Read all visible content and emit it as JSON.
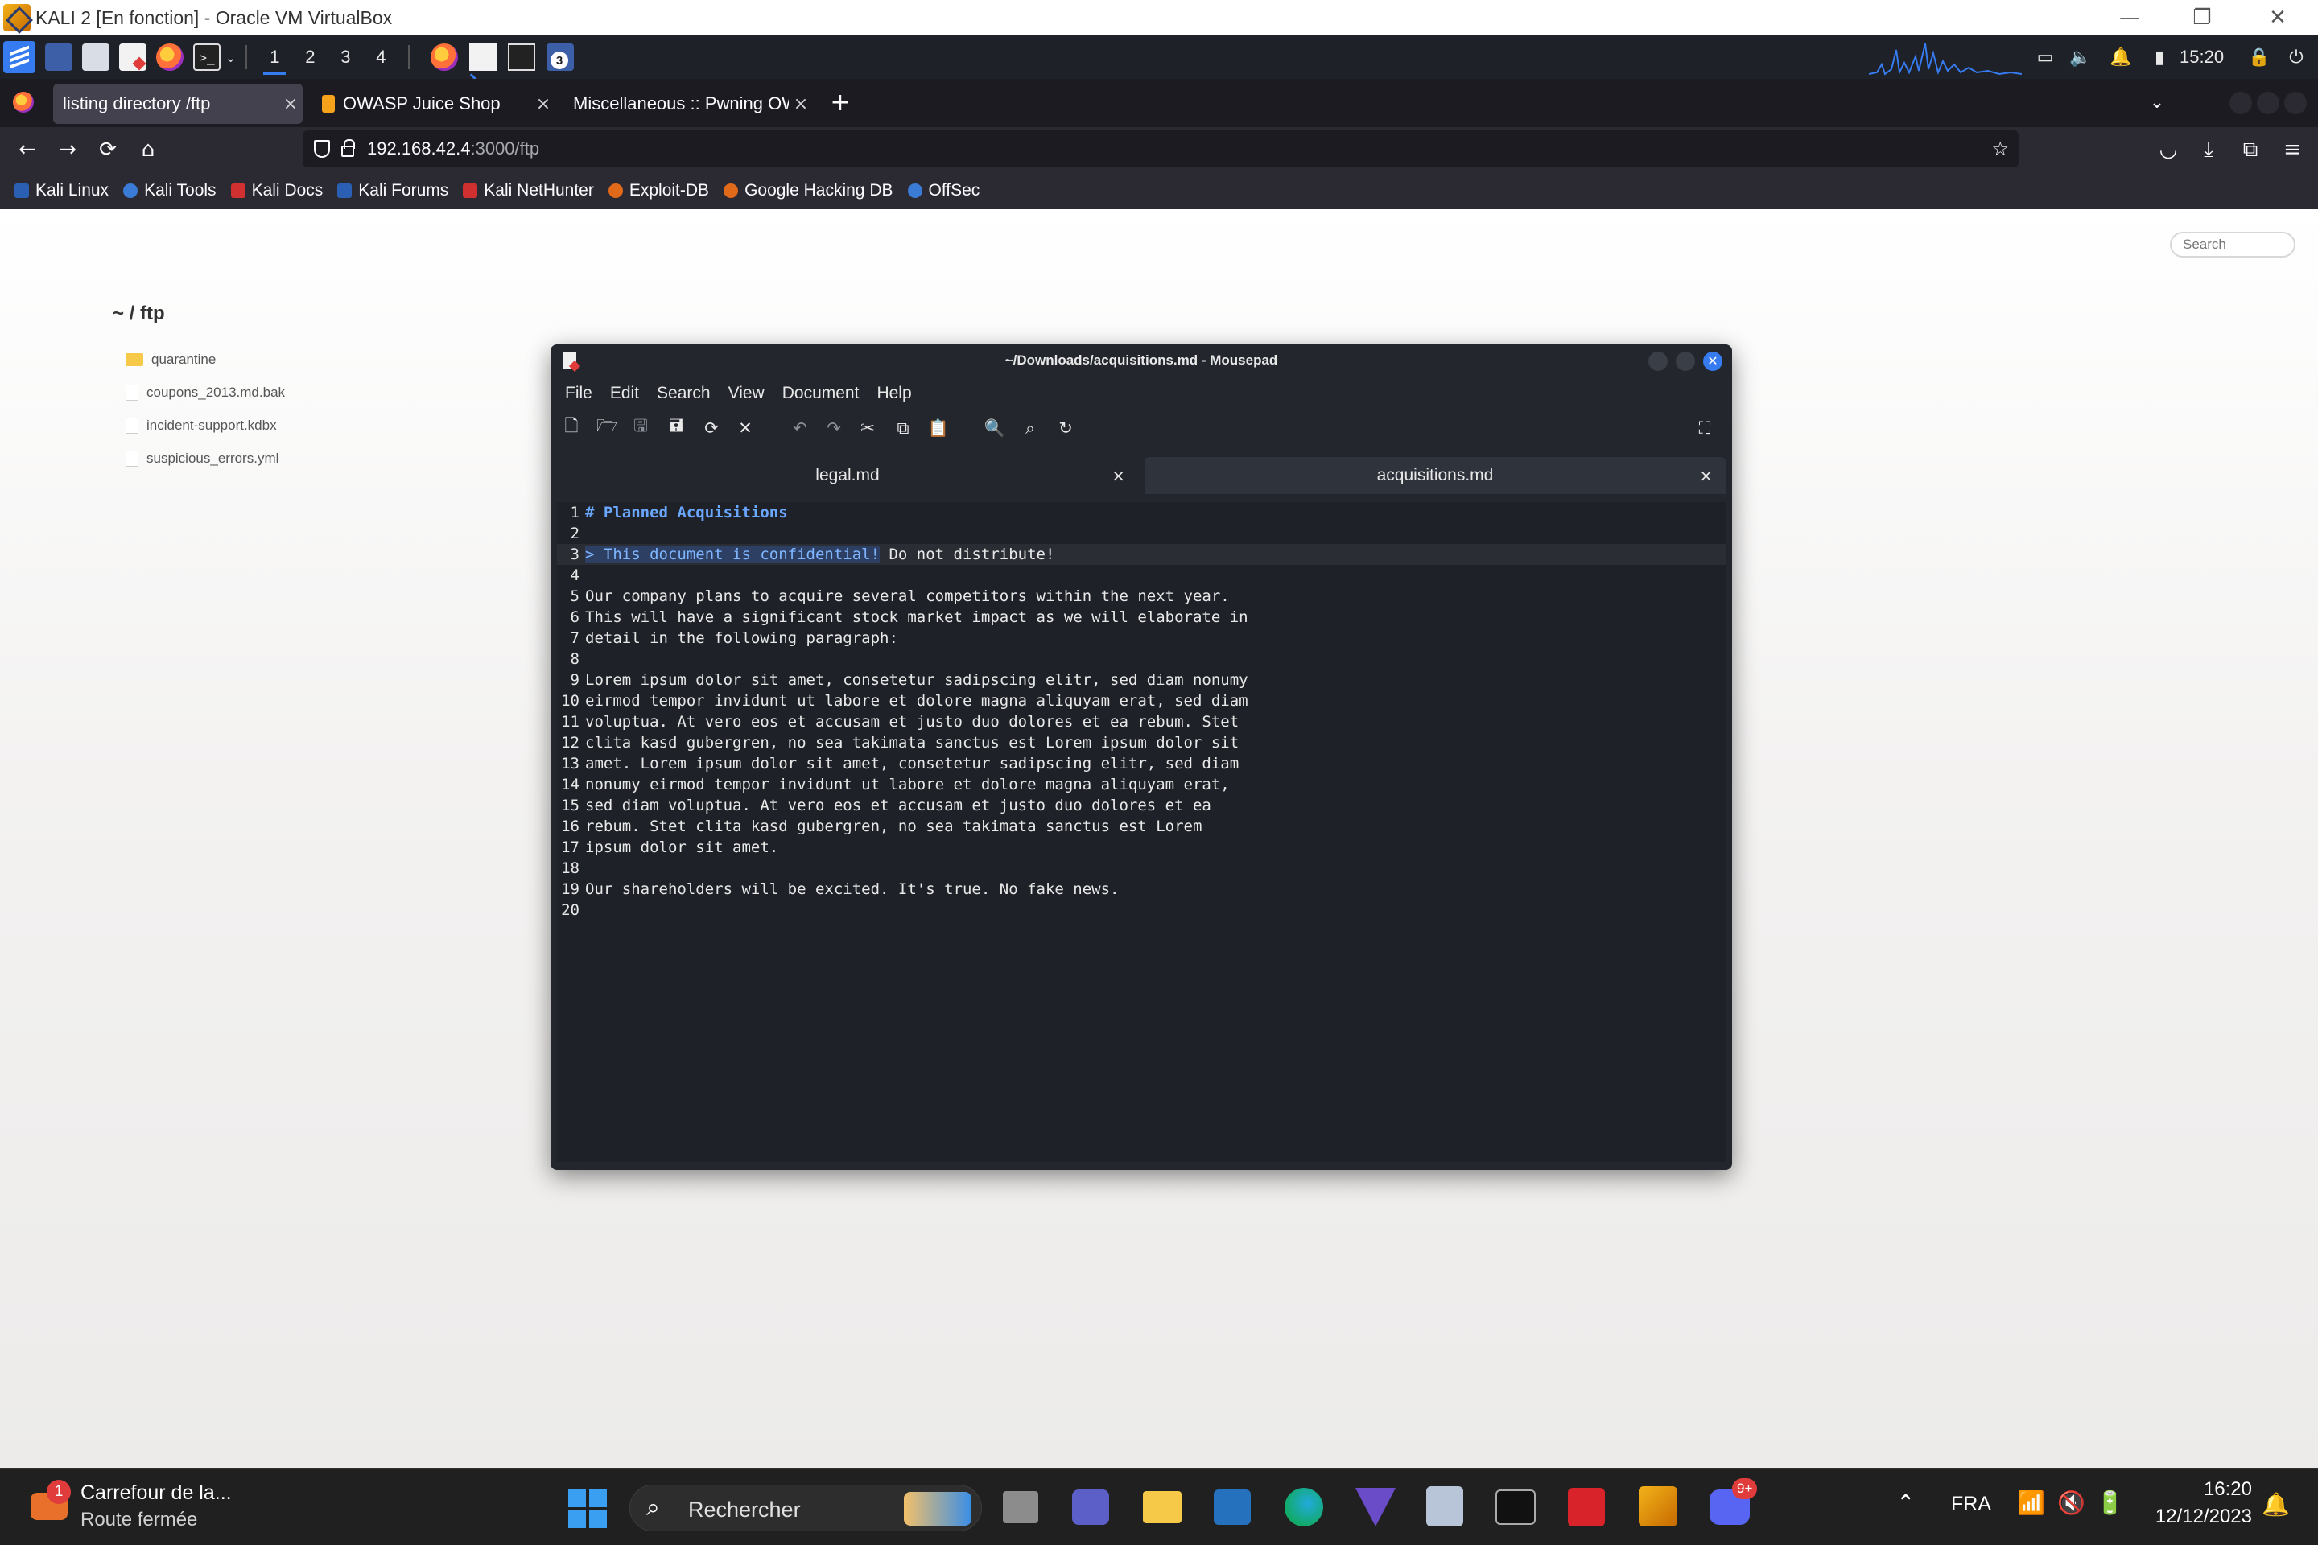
{
  "vbox": {
    "title": "KALI 2 [En fonction] - Oracle VM VirtualBox",
    "minimize": "—",
    "maximize": "❐",
    "close": "✕"
  },
  "kali_panel": {
    "workspaces": [
      "1",
      "2",
      "3",
      "4"
    ],
    "active_workspace": "1",
    "task_badge": "3",
    "terminal_glyph": ">_",
    "clock": "15:20",
    "icons": [
      "kali-menu-icon",
      "desktop-icon",
      "files-icon",
      "text-editor-icon",
      "firefox-icon",
      "terminal-icon",
      "network-graph-icon",
      "display-icon",
      "volume-icon",
      "notification-bell-icon",
      "battery-icon",
      "lock-icon",
      "power-icon"
    ]
  },
  "firefox": {
    "tabs": [
      {
        "label": "listing directory /ftp",
        "close": "×"
      },
      {
        "label": "OWASP Juice Shop",
        "close": "×"
      },
      {
        "label": "Miscellaneous :: Pwning OWASP Juice Shop",
        "close": "×"
      }
    ],
    "new_tab": "+",
    "tab_list": "⌄",
    "nav": {
      "back": "←",
      "forward": "→",
      "reload": "⟳",
      "home": "⌂"
    },
    "url_host": "192.168.42.4",
    "url_path": ":3000/ftp",
    "bookmark_star": "☆",
    "toolbar": {
      "pocket": "◡",
      "downloads": "⤓",
      "extensions": "⧉",
      "menu": "≡"
    },
    "bookmarks": [
      {
        "label": "Kali Linux",
        "color": "#2b5fb4"
      },
      {
        "label": "Kali Tools",
        "color": "#3a7bd5"
      },
      {
        "label": "Kali Docs",
        "color": "#d03030"
      },
      {
        "label": "Kali Forums",
        "color": "#2b5fb4"
      },
      {
        "label": "Kali NetHunter",
        "color": "#d03030"
      },
      {
        "label": "Exploit-DB",
        "color": "#e06a1a"
      },
      {
        "label": "Google Hacking DB",
        "color": "#e06a1a"
      },
      {
        "label": "OffSec",
        "color": "#3a7bd5"
      }
    ]
  },
  "page": {
    "search_placeholder": "Search",
    "title": "~ / ftp",
    "items": [
      {
        "name": "quarantine",
        "type": "folder"
      },
      {
        "name": "coupons_2013.md.bak",
        "type": "file"
      },
      {
        "name": "incident-support.kdbx",
        "type": "file"
      },
      {
        "name": "suspicious_errors.yml",
        "type": "file"
      }
    ]
  },
  "mousepad": {
    "title": "~/Downloads/acquisitions.md - Mousepad",
    "close_glyph": "✕",
    "menu": [
      "File",
      "Edit",
      "Search",
      "View",
      "Document",
      "Help"
    ],
    "toolbar": [
      "new",
      "open",
      "save",
      "save-as",
      "reload",
      "close",
      "undo",
      "redo",
      "cut",
      "copy",
      "paste",
      "find",
      "find-replace",
      "go-to-line",
      "fullscreen"
    ],
    "tabs": [
      {
        "label": "legal.md",
        "close": "×",
        "active": false
      },
      {
        "label": "acquisitions.md",
        "close": "×",
        "active": true
      }
    ],
    "lines": [
      {
        "n": "1",
        "text": "# Planned Acquisitions"
      },
      {
        "n": "2",
        "text": ""
      },
      {
        "n": "3",
        "text": "> This document is confidential! Do not distribute!"
      },
      {
        "n": "4",
        "text": ""
      },
      {
        "n": "5",
        "text": "Our company plans to acquire several competitors within the next year."
      },
      {
        "n": "6",
        "text": "This will have a significant stock market impact as we will elaborate in"
      },
      {
        "n": "7",
        "text": "detail in the following paragraph:"
      },
      {
        "n": "8",
        "text": ""
      },
      {
        "n": "9",
        "text": "Lorem ipsum dolor sit amet, consetetur sadipscing elitr, sed diam nonumy"
      },
      {
        "n": "10",
        "text": "eirmod tempor invidunt ut labore et dolore magna aliquyam erat, sed diam"
      },
      {
        "n": "11",
        "text": "voluptua. At vero eos et accusam et justo duo dolores et ea rebum. Stet"
      },
      {
        "n": "12",
        "text": "clita kasd gubergren, no sea takimata sanctus est Lorem ipsum dolor sit"
      },
      {
        "n": "13",
        "text": "amet. Lorem ipsum dolor sit amet, consetetur sadipscing elitr, sed diam"
      },
      {
        "n": "14",
        "text": "nonumy eirmod tempor invidunt ut labore et dolore magna aliquyam erat,"
      },
      {
        "n": "15",
        "text": "sed diam voluptua. At vero eos et accusam et justo duo dolores et ea"
      },
      {
        "n": "16",
        "text": "rebum. Stet clita kasd gubergren, no sea takimata sanctus est Lorem"
      },
      {
        "n": "17",
        "text": "ipsum dolor sit amet."
      },
      {
        "n": "18",
        "text": ""
      },
      {
        "n": "19",
        "text": "Our shareholders will be excited. It's true. No fake news."
      },
      {
        "n": "20",
        "text": ""
      }
    ],
    "line3_highlight": "> This document is confidential!",
    "line3_rest": " Do not distribute!"
  },
  "taskbar": {
    "notification_title": "Carrefour de la...",
    "notification_subtitle": "Route fermée",
    "notification_badge": "1",
    "search_placeholder": "Rechercher",
    "discord_badge": "9+",
    "language": "FRA",
    "time": "16:20",
    "date": "12/12/2023",
    "apps": [
      "start-icon",
      "search-icon",
      "task-view-icon",
      "teams-icon",
      "file-explorer-icon",
      "powershell-icon",
      "edge-icon",
      "vpn-icon",
      "virtualbox-icon",
      "terminal-icon",
      "acrobat-icon",
      "app-icon",
      "discord-icon"
    ]
  }
}
